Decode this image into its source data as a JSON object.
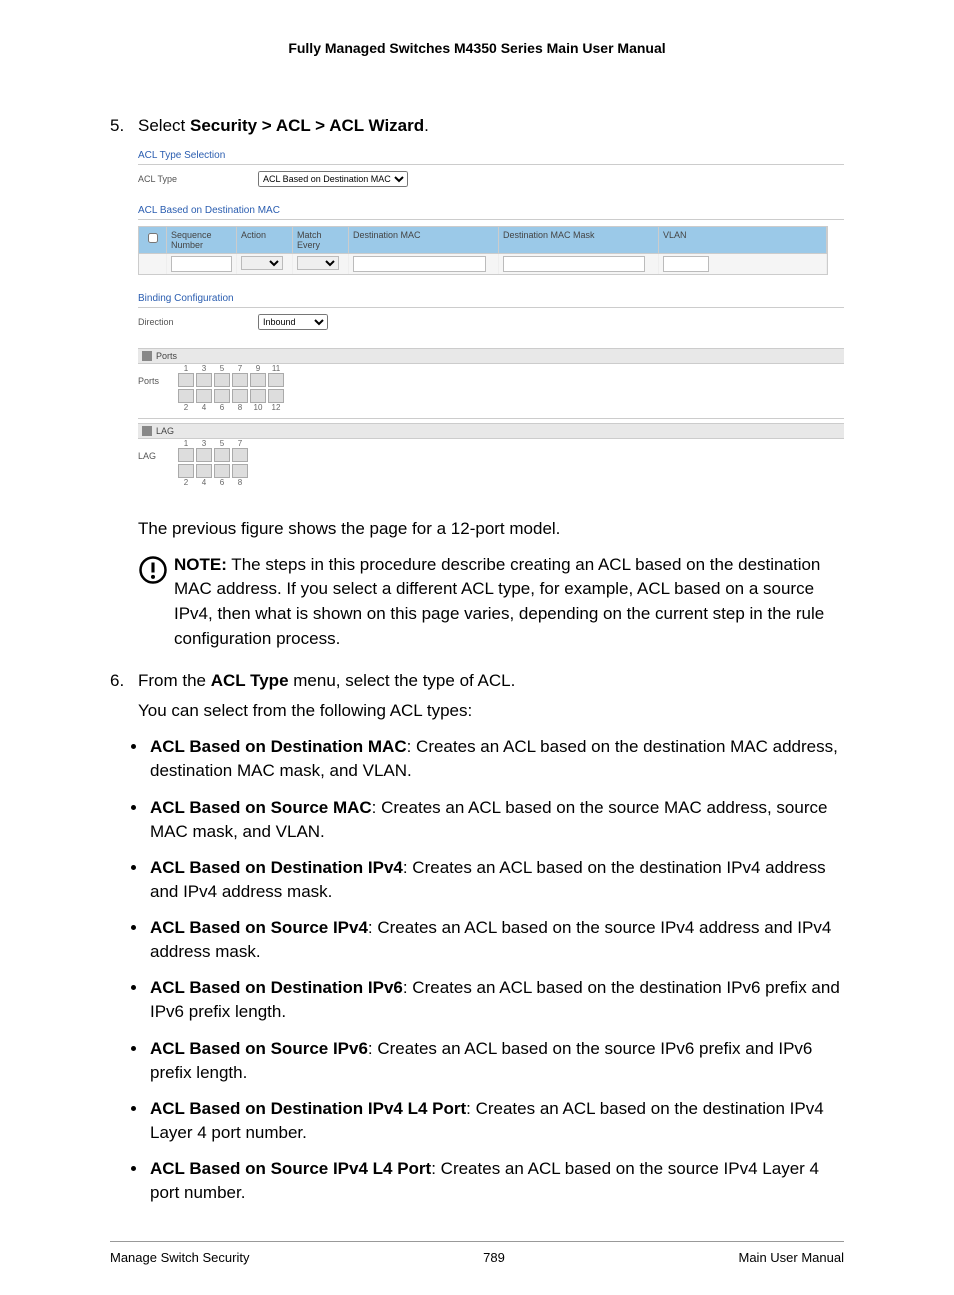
{
  "header": {
    "title": "Fully Managed Switches M4350 Series Main User Manual"
  },
  "step5": {
    "num": "5.",
    "prefix": "Select ",
    "breadcrumb": "Security > ACL > ACL Wizard",
    "suffix": "."
  },
  "shot": {
    "section1": "ACL Type Selection",
    "aclTypeLabel": "ACL Type",
    "aclTypeValue": "ACL Based on Destination MAC",
    "section2": "ACL Based on Destination MAC",
    "th": {
      "seq": "Sequence Number",
      "action": "Action",
      "me": "Match Every",
      "dmac": "Destination MAC",
      "mask": "Destination MAC Mask",
      "vlan": "VLAN"
    },
    "section3": "Binding Configuration",
    "dirLabel": "Direction",
    "dirValue": "Inbound",
    "portsBand": "Ports",
    "lagBand": "LAG",
    "portsLabel": "Ports",
    "lagLabel": "LAG",
    "top_ports": [
      "1",
      "3",
      "5",
      "7",
      "9",
      "11"
    ],
    "bot_ports": [
      "2",
      "4",
      "6",
      "8",
      "10",
      "12"
    ],
    "top_lag": [
      "1",
      "3",
      "5",
      "7"
    ],
    "bot_lag": [
      "2",
      "4",
      "6",
      "8"
    ]
  },
  "para_prev": "The previous figure shows the page for a 12-port model.",
  "note": {
    "label": "NOTE:",
    "text": " The steps in this procedure describe creating an ACL based on the destination MAC address. If you select a different ACL type, for example, ACL based on a source IPv4, then what is shown on this page varies, depending on the current step in the rule configuration process."
  },
  "step6": {
    "num": "6.",
    "prefix": "From the ",
    "bold": "ACL Type",
    "suffix": " menu, select the type of ACL."
  },
  "step6_after": "You can select from the following ACL types:",
  "acl_items": [
    {
      "b": "ACL Based on Destination MAC",
      "t": ": Creates an ACL based on the destination MAC address, destination MAC mask, and VLAN."
    },
    {
      "b": "ACL Based on Source MAC",
      "t": ": Creates an ACL based on the source MAC address, source MAC mask, and VLAN."
    },
    {
      "b": "ACL Based on Destination IPv4",
      "t": ": Creates an ACL based on the destination IPv4 address and IPv4 address mask."
    },
    {
      "b": "ACL Based on Source IPv4",
      "t": ": Creates an ACL based on the source IPv4 address and IPv4 address mask."
    },
    {
      "b": "ACL Based on Destination IPv6",
      "t": ": Creates an ACL based on the destination IPv6 prefix and IPv6 prefix length."
    },
    {
      "b": "ACL Based on Source IPv6",
      "t": ": Creates an ACL based on the source IPv6 prefix and IPv6 prefix length."
    },
    {
      "b": "ACL Based on Destination IPv4 L4 Port",
      "t": ": Creates an ACL based on the destination IPv4 Layer 4 port number."
    },
    {
      "b": "ACL Based on Source IPv4 L4 Port",
      "t": ": Creates an ACL based on the source IPv4 Layer 4 port number."
    }
  ],
  "footer": {
    "left": "Manage Switch Security",
    "center": "789",
    "right": "Main User Manual"
  }
}
